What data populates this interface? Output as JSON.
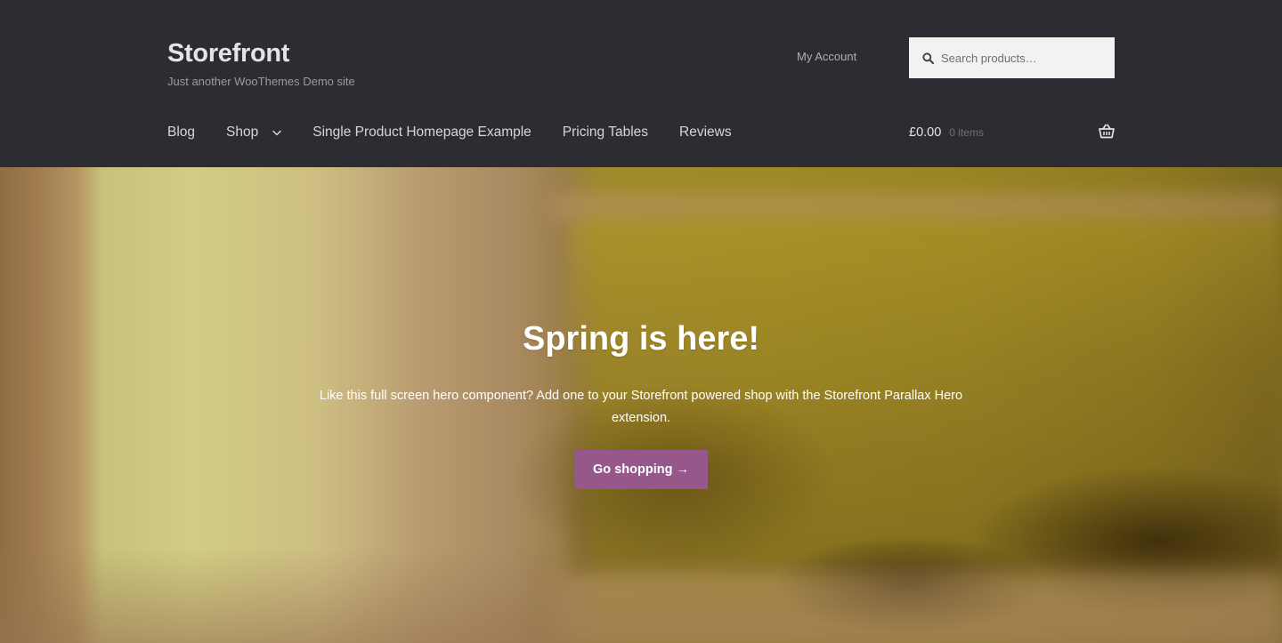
{
  "site": {
    "title": "Storefront",
    "tagline": "Just another WooThemes Demo site"
  },
  "header": {
    "my_account": "My Account",
    "search": {
      "placeholder": "Search products…",
      "icon": "search-icon"
    }
  },
  "nav": {
    "items": [
      {
        "label": "Blog"
      },
      {
        "label": "Shop",
        "has_dropdown": true,
        "icon": "chevron-down-icon"
      },
      {
        "label": "Single Product Homepage Example"
      },
      {
        "label": "Pricing Tables"
      },
      {
        "label": "Reviews"
      }
    ]
  },
  "cart": {
    "amount": "£0.00",
    "count": "0 items",
    "icon": "basket-icon"
  },
  "hero": {
    "title": "Spring is here!",
    "description": "Like this full screen hero component? Add one to your Storefront powered shop with the Storefront Parallax Hero extension.",
    "button_label": "Go shopping →"
  },
  "colors": {
    "header_bg": "#2c2d33",
    "accent": "#96588a",
    "search_bg": "#f2f2f2"
  }
}
